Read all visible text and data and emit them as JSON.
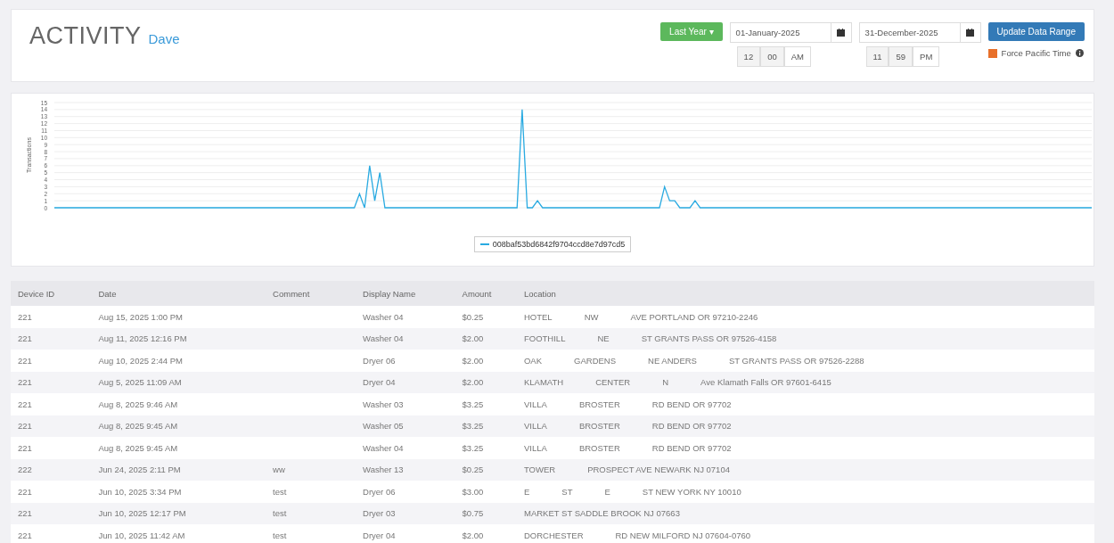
{
  "header": {
    "title": "ACTIVITY",
    "user": "Dave",
    "range_button": "Last Year ▾",
    "start": {
      "date": "01-January-2025",
      "hour": "12",
      "minute": "00",
      "ampm": "AM"
    },
    "end": {
      "date": "31-December-2025",
      "hour": "11",
      "minute": "59",
      "ampm": "PM"
    },
    "update_button": "Update Data Range",
    "force_pacific": {
      "label": "Force Pacific Time",
      "checked": true
    }
  },
  "chart": {
    "chart_data": {
      "type": "line",
      "grid": true,
      "ylabel": "Transactions",
      "ylim": [
        0,
        15
      ],
      "yticks": [
        0,
        1,
        2,
        3,
        4,
        5,
        6,
        7,
        8,
        9,
        10,
        11,
        12,
        13,
        14,
        15
      ],
      "series": [
        {
          "name": "008baf53bd6842f9704ccd8e7d97cd5",
          "color": "#29aae1",
          "values": [
            0,
            0,
            0,
            0,
            0,
            0,
            0,
            0,
            0,
            0,
            0,
            0,
            0,
            0,
            0,
            0,
            0,
            0,
            0,
            0,
            0,
            0,
            0,
            0,
            0,
            0,
            0,
            0,
            0,
            0,
            0,
            0,
            0,
            0,
            0,
            0,
            0,
            0,
            0,
            0,
            0,
            0,
            0,
            0,
            0,
            0,
            0,
            0,
            0,
            0,
            0,
            0,
            0,
            0,
            0,
            0,
            0,
            0,
            0,
            0,
            2,
            0,
            6,
            1,
            5,
            0,
            0,
            0,
            0,
            0,
            0,
            0,
            0,
            0,
            0,
            0,
            0,
            0,
            0,
            0,
            0,
            0,
            0,
            0,
            0,
            0,
            0,
            0,
            0,
            0,
            0,
            0,
            14,
            0,
            0,
            1,
            0,
            0,
            0,
            0,
            0,
            0,
            0,
            0,
            0,
            0,
            0,
            0,
            0,
            0,
            0,
            0,
            0,
            0,
            0,
            0,
            0,
            0,
            0,
            0,
            3,
            1,
            1,
            0,
            0,
            0,
            1,
            0,
            0,
            0,
            0,
            0,
            0,
            0,
            0,
            0,
            0,
            0,
            0,
            0,
            0,
            0,
            0,
            0,
            0,
            0,
            0,
            0,
            0,
            0,
            0,
            0,
            0,
            0,
            0,
            0,
            0,
            0,
            0,
            0,
            0,
            0,
            0,
            0,
            0,
            0,
            0,
            0,
            0,
            0,
            0,
            0,
            0,
            0,
            0,
            0,
            0,
            0,
            0,
            0,
            0,
            0,
            0,
            0,
            0,
            0,
            0,
            0,
            0,
            0,
            0,
            0,
            0,
            0,
            0,
            0,
            0,
            0,
            0,
            0,
            0,
            0,
            0,
            0,
            0
          ]
        }
      ]
    }
  },
  "table": {
    "columns": [
      "Device ID",
      "Date",
      "Comment",
      "Display Name",
      "Amount",
      "Location"
    ],
    "rows": [
      {
        "device": "221",
        "date": "Aug 15, 2025 1:00 PM",
        "comment": "",
        "name": "Washer 04",
        "amount": "$0.25",
        "location": [
          "HOTEL",
          "NW",
          "AVE PORTLAND OR 97210-2246"
        ]
      },
      {
        "device": "221",
        "date": "Aug 11, 2025 12:16 PM",
        "comment": "",
        "name": "Washer 04",
        "amount": "$2.00",
        "location": [
          "FOOTHILL",
          "NE",
          "ST GRANTS PASS OR 97526-4158"
        ]
      },
      {
        "device": "221",
        "date": "Aug 10, 2025 2:44 PM",
        "comment": "",
        "name": "Dryer 06",
        "amount": "$2.00",
        "location": [
          "OAK",
          "GARDENS",
          "NE ANDERS",
          "ST GRANTS PASS OR 97526-2288"
        ]
      },
      {
        "device": "221",
        "date": "Aug 5, 2025 11:09 AM",
        "comment": "",
        "name": "Dryer 04",
        "amount": "$2.00",
        "location": [
          "KLAMATH",
          "CENTER",
          "N",
          "Ave Klamath Falls OR 97601-6415"
        ]
      },
      {
        "device": "221",
        "date": "Aug 8, 2025 9:46 AM",
        "comment": "",
        "name": "Washer 03",
        "amount": "$3.25",
        "location": [
          "VILLA",
          "BROSTER",
          "RD BEND OR 97702"
        ]
      },
      {
        "device": "221",
        "date": "Aug 8, 2025 9:45 AM",
        "comment": "",
        "name": "Washer 05",
        "amount": "$3.25",
        "location": [
          "VILLA",
          "BROSTER",
          "RD BEND OR 97702"
        ]
      },
      {
        "device": "221",
        "date": "Aug 8, 2025 9:45 AM",
        "comment": "",
        "name": "Washer 04",
        "amount": "$3.25",
        "location": [
          "VILLA",
          "BROSTER",
          "RD BEND OR 97702"
        ]
      },
      {
        "device": "222",
        "date": "Jun 24, 2025 2:11 PM",
        "comment": "ww",
        "name": "Washer 13",
        "amount": "$0.25",
        "location": [
          "TOWER",
          "PROSPECT AVE NEWARK NJ 07104"
        ]
      },
      {
        "device": "221",
        "date": "Jun 10, 2025 3:34 PM",
        "comment": "test",
        "name": "Dryer 06",
        "amount": "$3.00",
        "location": [
          "E",
          "ST",
          "E",
          "ST NEW YORK NY 10010"
        ]
      },
      {
        "device": "221",
        "date": "Jun 10, 2025 12:17 PM",
        "comment": "test",
        "name": "Dryer 03",
        "amount": "$0.75",
        "location": [
          "MARKET ST SADDLE BROOK NJ 07663"
        ]
      },
      {
        "device": "221",
        "date": "Jun 10, 2025 11:42 AM",
        "comment": "test",
        "name": "Dryer 04",
        "amount": "$2.00",
        "location": [
          "DORCHESTER",
          "RD NEW MILFORD NJ 07604-0760"
        ]
      }
    ]
  }
}
